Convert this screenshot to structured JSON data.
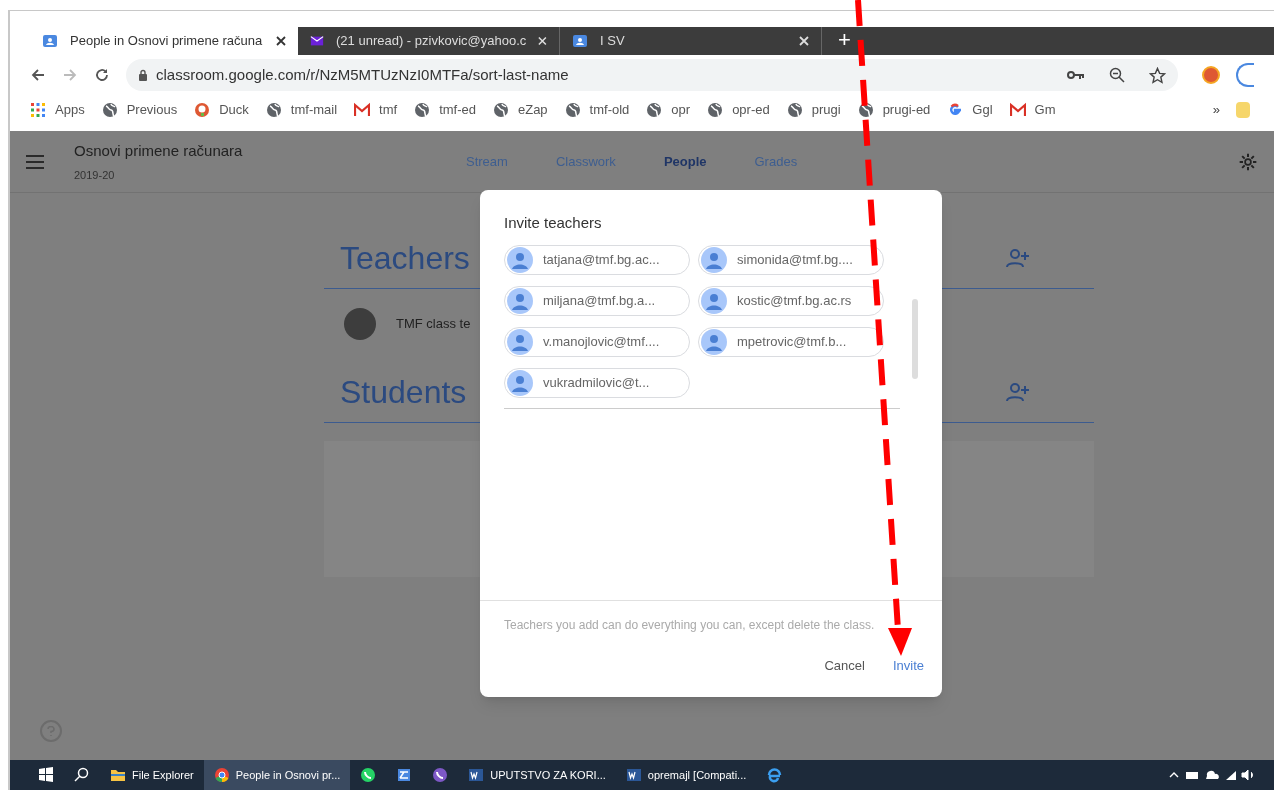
{
  "browser": {
    "tabs": [
      {
        "title": "People in Osnovi primene računa",
        "selected": true,
        "kind": "classroom"
      },
      {
        "title": "(21 unread) - pzivkovic@yahoo.c",
        "selected": false,
        "kind": "mail"
      },
      {
        "title": "I SV",
        "selected": false,
        "kind": "classroom"
      }
    ],
    "new_tab": "+",
    "url": "classroom.google.com/r/NzM5MTUzNzI0MTFa/sort-last-name",
    "bookmarks": [
      {
        "label": "Apps",
        "kind": "apps"
      },
      {
        "label": "Previous",
        "kind": "globe"
      },
      {
        "label": "Duck",
        "kind": "duck"
      },
      {
        "label": "tmf-mail",
        "kind": "globe"
      },
      {
        "label": "tmf",
        "kind": "gmail"
      },
      {
        "label": "tmf-ed",
        "kind": "globe"
      },
      {
        "label": "eZap",
        "kind": "globe"
      },
      {
        "label": "tmf-old",
        "kind": "globe"
      },
      {
        "label": "opr",
        "kind": "globe"
      },
      {
        "label": "opr-ed",
        "kind": "globe"
      },
      {
        "label": "prugi",
        "kind": "globe"
      },
      {
        "label": "prugi-ed",
        "kind": "globe"
      },
      {
        "label": "Ggl",
        "kind": "google"
      },
      {
        "label": "Gm",
        "kind": "gmail"
      }
    ],
    "more_bookmarks": "»"
  },
  "page": {
    "course_title": "Osnovi primene računara",
    "course_year": "2019-20",
    "nav": [
      {
        "label": "Stream",
        "selected": false
      },
      {
        "label": "Classwork",
        "selected": false
      },
      {
        "label": "People",
        "selected": true
      },
      {
        "label": "Grades",
        "selected": false
      }
    ],
    "teachers_heading": "Teachers",
    "teacher_name": "TMF class te",
    "students_heading": "Students"
  },
  "dialog": {
    "title": "Invite teachers",
    "chips": [
      "tatjana@tmf.bg.ac...",
      "simonida@tmf.bg....",
      "miljana@tmf.bg.a...",
      "kostic@tmf.bg.ac.rs",
      "v.manojlovic@tmf....",
      "mpetrovic@tmf.b...",
      "vukradmilovic@t..."
    ],
    "note": "Teachers you add can do everything you can, except delete the class.",
    "cancel": "Cancel",
    "invite": "Invite"
  },
  "taskbar": [
    {
      "kind": "start"
    },
    {
      "kind": "search"
    },
    {
      "kind": "folder",
      "label": "File Explorer",
      "active": false
    },
    {
      "kind": "chrome",
      "label": "People in Osnovi pr...",
      "active": true
    },
    {
      "kind": "whatsapp"
    },
    {
      "kind": "scanner"
    },
    {
      "kind": "viber"
    },
    {
      "kind": "word",
      "label": "UPUTSTVO ZA KORI...",
      "active": false
    },
    {
      "kind": "word",
      "label": "opremajl [Compati...",
      "active": false
    },
    {
      "kind": "edge"
    }
  ]
}
